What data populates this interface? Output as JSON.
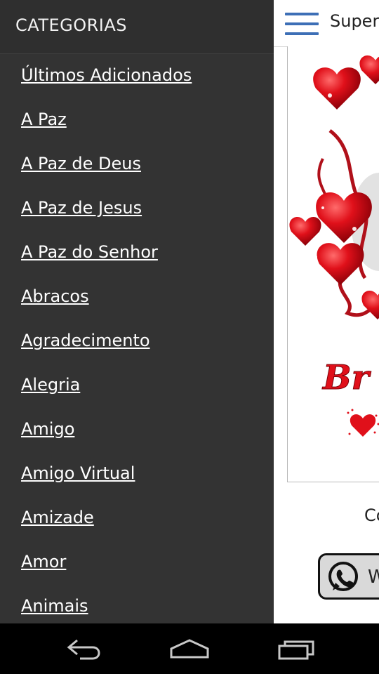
{
  "drawer": {
    "title": "CATEGORIAS",
    "items": [
      {
        "label": "Últimos Adicionados"
      },
      {
        "label": "A Paz"
      },
      {
        "label": "A Paz de Deus"
      },
      {
        "label": "A Paz de Jesus"
      },
      {
        "label": "A Paz do Senhor"
      },
      {
        "label": "Abracos"
      },
      {
        "label": "Agradecimento"
      },
      {
        "label": "Alegria"
      },
      {
        "label": "Amigo"
      },
      {
        "label": "Amigo Virtual"
      },
      {
        "label": "Amizade"
      },
      {
        "label": "Amor"
      },
      {
        "label": "Animais"
      }
    ]
  },
  "appbar": {
    "title": "Super",
    "menu_icon": "hamburger-menu-icon",
    "accent": "#3d6fb6"
  },
  "content": {
    "caption": "Co",
    "whatsapp_button": {
      "label": "W",
      "icon": "whatsapp-icon"
    }
  },
  "colors": {
    "drawer_bg": "#333333",
    "heart_red": "#d8101a"
  },
  "system_nav": {
    "back_icon": "back-icon",
    "home_icon": "home-icon",
    "recents_icon": "recent-apps-icon"
  }
}
